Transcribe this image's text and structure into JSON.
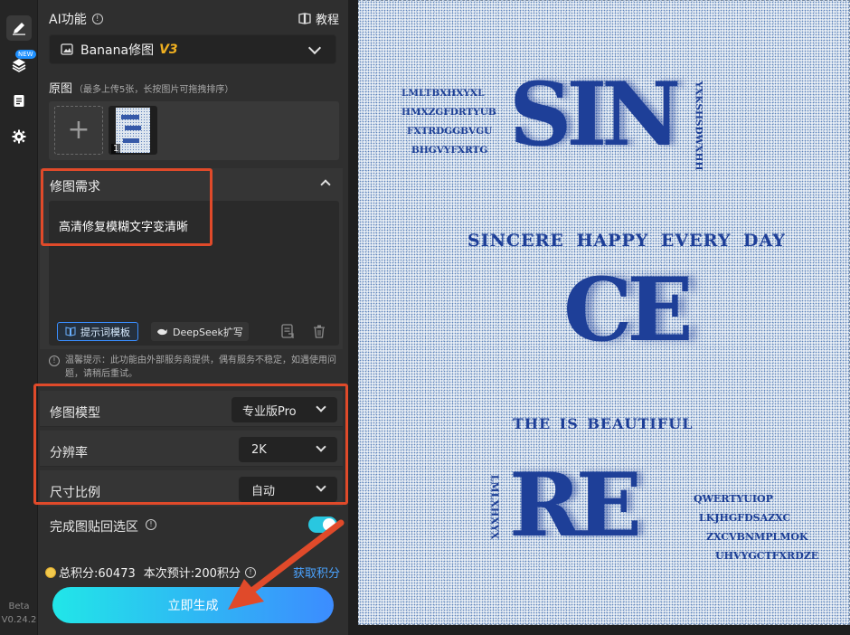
{
  "rail": {
    "new_badge": "NEW",
    "beta": "Beta",
    "version": "V0.24.2"
  },
  "header": {
    "title": "AI功能",
    "tutorial": "教程"
  },
  "model_select": {
    "name": "Banana修图",
    "version": "V3"
  },
  "source": {
    "title": "原图",
    "hint": "（最多上传5张，长按图片可拖拽排序）",
    "thumb_index": "1"
  },
  "request": {
    "title": "修图需求",
    "text": "高清修复模糊文字变清晰",
    "template_btn": "提示词模板",
    "deepseek_btn": "DeepSeek扩写"
  },
  "notice": "温馨提示：此功能由外部服务商提供，偶有服务不稳定，如遇使用问题，请稍后重试。",
  "settings": [
    {
      "label": "修图模型",
      "value": "专业版Pro"
    },
    {
      "label": "分辨率",
      "value": "2K"
    },
    {
      "label": "尺寸比例",
      "value": "自动"
    }
  ],
  "toggle": {
    "label": "完成图贴回选区",
    "on": true
  },
  "points": {
    "total": "总积分:60473",
    "estimate": "本次预计:200积分",
    "get": "获取积分"
  },
  "generate": "立即生成",
  "poster": {
    "left_lines": [
      "LMLTBXHXYXL",
      "HMXZGFDRTYUB",
      "FXTRDGGBVGU",
      "BHGVYFXRTG"
    ],
    "big1": "SIN",
    "vertical_right": "YXKSHSDWXHH",
    "tagline": "SINCERE HAPPY EVERY DAY",
    "big2": "CE",
    "subtitle": "THE IS BEAUTIFUL",
    "vertical_left": "LMLXHXYX",
    "big3": "RE",
    "right_lines": [
      "QWERTYUIOP",
      "LKJHGFDSAZXC",
      "ZXCVBNMPLMOK",
      "UHVYGCTFXRDZE"
    ]
  },
  "colors": {
    "accent_red": "#e04a2a",
    "gradient_start": "#21e6e8",
    "gradient_end": "#3c8cff",
    "poster_blue": "#1d3f96",
    "link_blue": "#4aa3ff",
    "version_gold": "#f0b020"
  }
}
